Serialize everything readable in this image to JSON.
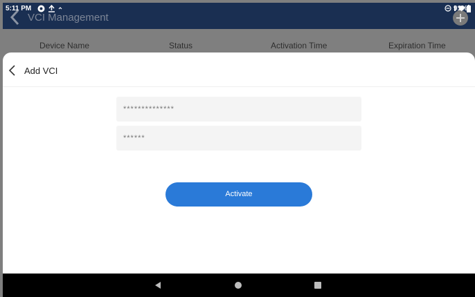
{
  "status_bar": {
    "time": "5:11 PM",
    "battery": "91%",
    "icons": [
      "settings-icon",
      "upload-icon",
      "notification-dot-icon",
      "do-not-disturb-icon",
      "vibrate-icon",
      "wifi-icon",
      "battery-icon"
    ]
  },
  "background_app": {
    "title": "VCI Management",
    "columns": [
      "Device Name",
      "Status",
      "Activation Time",
      "Expiration Time"
    ]
  },
  "sheet": {
    "title": "Add VCI",
    "serial_field": {
      "value": "**************"
    },
    "code_field": {
      "value": "******"
    },
    "activate_label": "Activate"
  },
  "colors": {
    "header_bg": "#1a2f52",
    "primary_button": "#2a7ad8",
    "overlay": "#7f7f7f",
    "field_bg": "#f4f4f4"
  }
}
